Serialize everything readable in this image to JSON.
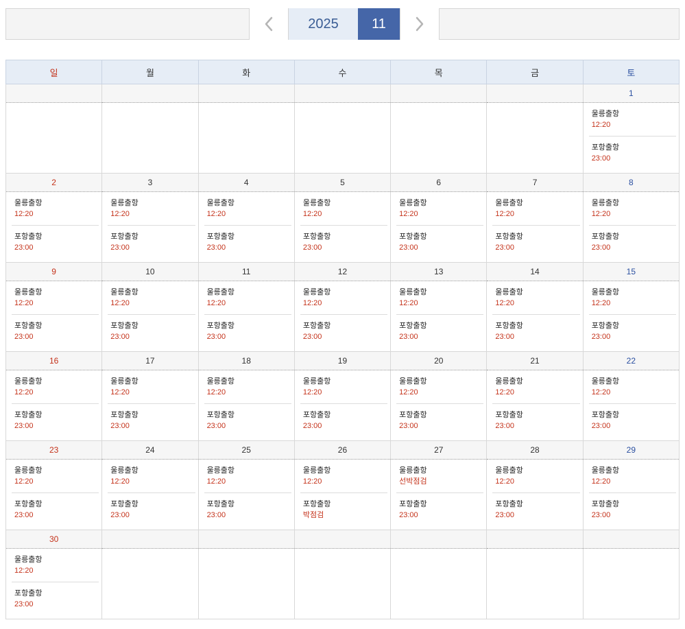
{
  "nav": {
    "year": "2025",
    "month": "11",
    "prev_label": "<",
    "next_label": ">"
  },
  "weekdays": [
    "일",
    "월",
    "화",
    "수",
    "목",
    "금",
    "토"
  ],
  "weeks": [
    [
      {
        "date": ""
      },
      {
        "date": ""
      },
      {
        "date": ""
      },
      {
        "date": ""
      },
      {
        "date": ""
      },
      {
        "date": ""
      },
      {
        "date": "1",
        "events": [
          {
            "name": "울릉출항",
            "time": "12:20"
          },
          {
            "name": "포항출항",
            "time": "23:00"
          }
        ]
      }
    ],
    [
      {
        "date": "2",
        "events": [
          {
            "name": "울릉출항",
            "time": "12:20"
          },
          {
            "name": "포항출항",
            "time": "23:00"
          }
        ]
      },
      {
        "date": "3",
        "events": [
          {
            "name": "울릉출항",
            "time": "12:20"
          },
          {
            "name": "포항출항",
            "time": "23:00"
          }
        ]
      },
      {
        "date": "4",
        "events": [
          {
            "name": "울릉출항",
            "time": "12:20"
          },
          {
            "name": "포항출항",
            "time": "23:00"
          }
        ]
      },
      {
        "date": "5",
        "events": [
          {
            "name": "울릉출항",
            "time": "12:20"
          },
          {
            "name": "포항출항",
            "time": "23:00"
          }
        ]
      },
      {
        "date": "6",
        "events": [
          {
            "name": "울릉출항",
            "time": "12:20"
          },
          {
            "name": "포항출항",
            "time": "23:00"
          }
        ]
      },
      {
        "date": "7",
        "events": [
          {
            "name": "울릉출항",
            "time": "12:20"
          },
          {
            "name": "포항출항",
            "time": "23:00"
          }
        ]
      },
      {
        "date": "8",
        "events": [
          {
            "name": "울릉출항",
            "time": "12:20"
          },
          {
            "name": "포항출항",
            "time": "23:00"
          }
        ]
      }
    ],
    [
      {
        "date": "9",
        "events": [
          {
            "name": "울릉출항",
            "time": "12:20"
          },
          {
            "name": "포항출항",
            "time": "23:00"
          }
        ]
      },
      {
        "date": "10",
        "events": [
          {
            "name": "울릉출항",
            "time": "12:20"
          },
          {
            "name": "포항출항",
            "time": "23:00"
          }
        ]
      },
      {
        "date": "11",
        "events": [
          {
            "name": "울릉출항",
            "time": "12:20"
          },
          {
            "name": "포항출항",
            "time": "23:00"
          }
        ]
      },
      {
        "date": "12",
        "events": [
          {
            "name": "울릉출항",
            "time": "12:20"
          },
          {
            "name": "포항출항",
            "time": "23:00"
          }
        ]
      },
      {
        "date": "13",
        "events": [
          {
            "name": "울릉출항",
            "time": "12:20"
          },
          {
            "name": "포항출항",
            "time": "23:00"
          }
        ]
      },
      {
        "date": "14",
        "events": [
          {
            "name": "울릉출항",
            "time": "12:20"
          },
          {
            "name": "포항출항",
            "time": "23:00"
          }
        ]
      },
      {
        "date": "15",
        "events": [
          {
            "name": "울릉출항",
            "time": "12:20"
          },
          {
            "name": "포항출항",
            "time": "23:00"
          }
        ]
      }
    ],
    [
      {
        "date": "16",
        "events": [
          {
            "name": "울릉출항",
            "time": "12:20"
          },
          {
            "name": "포항출항",
            "time": "23:00"
          }
        ]
      },
      {
        "date": "17",
        "events": [
          {
            "name": "울릉출항",
            "time": "12:20"
          },
          {
            "name": "포항출항",
            "time": "23:00"
          }
        ]
      },
      {
        "date": "18",
        "events": [
          {
            "name": "울릉출항",
            "time": "12:20"
          },
          {
            "name": "포항출항",
            "time": "23:00"
          }
        ]
      },
      {
        "date": "19",
        "events": [
          {
            "name": "울릉출항",
            "time": "12:20"
          },
          {
            "name": "포항출항",
            "time": "23:00"
          }
        ]
      },
      {
        "date": "20",
        "events": [
          {
            "name": "울릉출항",
            "time": "12:20"
          },
          {
            "name": "포항출항",
            "time": "23:00"
          }
        ]
      },
      {
        "date": "21",
        "events": [
          {
            "name": "울릉출항",
            "time": "12:20"
          },
          {
            "name": "포항출항",
            "time": "23:00"
          }
        ]
      },
      {
        "date": "22",
        "events": [
          {
            "name": "울릉출항",
            "time": "12:20"
          },
          {
            "name": "포항출항",
            "time": "23:00"
          }
        ]
      }
    ],
    [
      {
        "date": "23",
        "events": [
          {
            "name": "울릉출항",
            "time": "12:20"
          },
          {
            "name": "포항출항",
            "time": "23:00"
          }
        ]
      },
      {
        "date": "24",
        "events": [
          {
            "name": "울릉출항",
            "time": "12:20"
          },
          {
            "name": "포항출항",
            "time": "23:00"
          }
        ]
      },
      {
        "date": "25",
        "events": [
          {
            "name": "울릉출항",
            "time": "12:20"
          },
          {
            "name": "포항출항",
            "time": "23:00"
          }
        ]
      },
      {
        "date": "26",
        "events": [
          {
            "name": "울릉출항",
            "time": "12:20"
          },
          {
            "name": "포항출항",
            "time": "박점검"
          }
        ]
      },
      {
        "date": "27",
        "events": [
          {
            "name": "울릉출항",
            "time": "선박점검"
          },
          {
            "name": "포항출항",
            "time": "23:00"
          }
        ]
      },
      {
        "date": "28",
        "events": [
          {
            "name": "울릉출항",
            "time": "12:20"
          },
          {
            "name": "포항출항",
            "time": "23:00"
          }
        ]
      },
      {
        "date": "29",
        "events": [
          {
            "name": "울릉출항",
            "time": "12:20"
          },
          {
            "name": "포항출항",
            "time": "23:00"
          }
        ]
      }
    ],
    [
      {
        "date": "30",
        "events": [
          {
            "name": "울릉출항",
            "time": "12:20"
          },
          {
            "name": "포항출항",
            "time": "23:00"
          }
        ]
      },
      {
        "date": ""
      },
      {
        "date": ""
      },
      {
        "date": ""
      },
      {
        "date": ""
      },
      {
        "date": ""
      },
      {
        "date": ""
      }
    ]
  ]
}
